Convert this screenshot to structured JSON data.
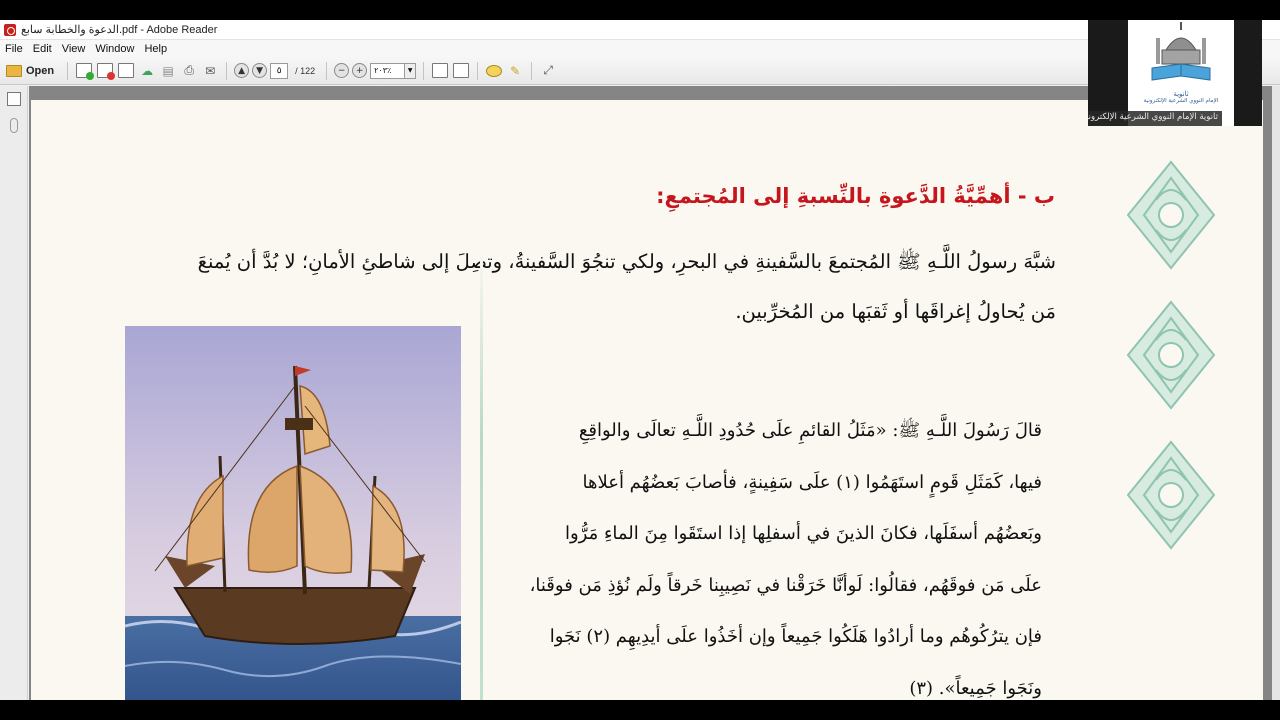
{
  "window": {
    "title": "الدعوة والخطابة سابع.pdf - Adobe Reader"
  },
  "menu": [
    "File",
    "Edit",
    "View",
    "Window",
    "Help"
  ],
  "toolbar": {
    "open_label": "Open",
    "current_page": "٥",
    "total_pages": "/ 122",
    "zoom": "٢٠٣٪"
  },
  "webcam": {
    "logo_title": "ثانوية",
    "logo_subtitle": "الإمام النووي الشرعية الإلكترونية",
    "caption": "ثانوية الإمام النووي الشرعية الإلكترونية"
  },
  "document": {
    "heading": "ب - أهمِّيَّةُ الدَّعوةِ بالنِّسبةِ إلى المُجتمعِ:",
    "paragraph_lines": [
      "شبَّهَ رسولُ اللَّـهِ ﷺ المُجتمعَ بالسَّفينةِ في البحرِ، ولكي تنجُوَ السَّفينةُ، وتصِلَ إلى شاطئِ الأمانِ؛ لا بُدَّ أن يُمنعَ",
      "مَن يُحاولُ إغراقَها أو ثَقبَها من المُخرِّبين."
    ],
    "hadith_lines": [
      "قالَ رَسُولَ اللَّـهِ ﷺ: «مَثَلُ القائمِ علَى حُدُودِ اللَّـهِ تعالَى والواقِعِ",
      "فيها، كَمَثَلِ قَومٍ استَهَمُوا (١) علَى سَفِينةٍ، فأصابَ بَعضُهُم أعلاها",
      "وبَعضُهُم أسفَلَها، فكانَ الذينَ في أسفلِها إذا استَقَوا مِنَ الماءِ مَرُّوا",
      "علَى مَن فوقَهُم، فقالُوا: لَوأنَّا خَرَقْنا في نَصِيبِنا خَرقاً ولَم نُؤذِ مَن فوقَنا،",
      "فإن يترُكُوهُم وما أرادُوا هَلَكُوا جَمِيعاً وإن أخَذُوا علَى أيدِيهِم (٢) نَجَوا",
      "ونَجَوا جَمِيعاً». (٣)"
    ]
  },
  "colors": {
    "heading": "#c4161c",
    "page_bg": "#fbf8f1",
    "ornament": "#8fc4b0",
    "divider": "#b9d8c6"
  }
}
